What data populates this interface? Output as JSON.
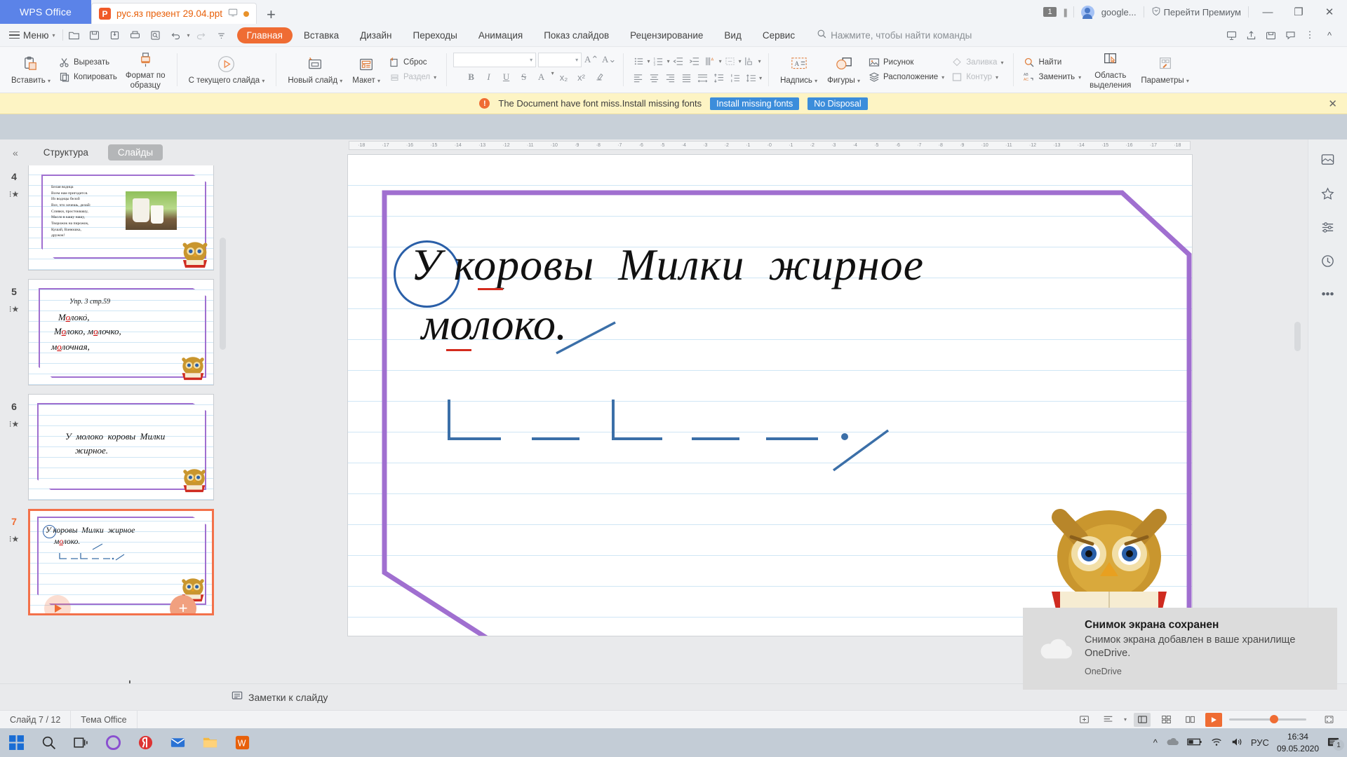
{
  "titlebar": {
    "app_name": "WPS Office",
    "doc_tab": {
      "label": "рус.яз презент 29.04.ppt",
      "badge": "P"
    },
    "new_tab": "+",
    "window_count": "1",
    "account": "google...",
    "premium": "Перейти Премиум",
    "minimize": "—",
    "restore": "❐",
    "close": "✕"
  },
  "menubar": {
    "menu_label": "Меню",
    "tabs": [
      {
        "label": "Главная",
        "active": true
      },
      {
        "label": "Вставка",
        "active": false
      },
      {
        "label": "Дизайн",
        "active": false
      },
      {
        "label": "Переходы",
        "active": false
      },
      {
        "label": "Анимация",
        "active": false
      },
      {
        "label": "Показ слайдов",
        "active": false
      },
      {
        "label": "Рецензирование",
        "active": false
      },
      {
        "label": "Вид",
        "active": false
      },
      {
        "label": "Сервис",
        "active": false
      }
    ],
    "search_placeholder": "Нажмите, чтобы найти команды"
  },
  "ribbon": {
    "paste": "Вставить",
    "cut": "Вырезать",
    "copy": "Копировать",
    "format_painter_l1": "Формат по",
    "format_painter_l2": "образцу",
    "from_current_slide": "С текущего слайда",
    "new_slide": "Новый слайд",
    "layout": "Макет",
    "reset": "Сброс",
    "section": "Раздел",
    "font_name": "",
    "font_size": "",
    "bold": "B",
    "italic": "I",
    "underline": "U",
    "strike": "S",
    "text_color": "A",
    "textbox": "Надпись",
    "shapes": "Фигуры",
    "picture": "Рисунок",
    "arrange": "Расположение",
    "fill": "Заливка",
    "outline": "Контур",
    "find": "Найти",
    "replace": "Заменить",
    "selection_pane_l1": "Область",
    "selection_pane_l2": "выделения",
    "parameters": "Параметры"
  },
  "notice": {
    "message": "The Document have font miss.Install missing fonts",
    "install_button": "Install missing fonts",
    "dismiss_button": "No Disposal",
    "close": "✕"
  },
  "sidebar": {
    "collapse": "«",
    "tab_outline": "Структура",
    "tab_slides": "Слайды",
    "add_slide": "+",
    "slides": [
      {
        "number": "4",
        "selected": false,
        "poem": [
          "Белая водица",
          "Всем нам пригодится.",
          "Из водицы белой",
          "Все, что хочешь, делай:",
          "Сливки, простоквашу,",
          "Масло в кашу нашу,",
          "Творожок на пирожок,",
          "Кушай, Ванюшка,",
          "дружок!"
        ]
      },
      {
        "number": "5",
        "selected": false,
        "heading": "Упр. 3 стр.59",
        "lines": [
          "Молоко,",
          "Молоко, молочко,",
          "молочная,"
        ]
      },
      {
        "number": "6",
        "selected": false,
        "lines": [
          "У  молоко  коровы  Милки",
          "жирное."
        ]
      },
      {
        "number": "7",
        "selected": true,
        "lines": [
          "У  коровы  Милки  жирное",
          "молоко."
        ]
      }
    ]
  },
  "editor": {
    "ruler_marks": [
      "18",
      "17",
      "16",
      "15",
      "14",
      "13",
      "12",
      "11",
      "10",
      "9",
      "8",
      "7",
      "6",
      "5",
      "4",
      "3",
      "2",
      "1",
      "0",
      "1",
      "2",
      "3",
      "4",
      "5",
      "6",
      "7",
      "8",
      "9",
      "10",
      "11",
      "12",
      "13",
      "14",
      "15",
      "16",
      "17",
      "18"
    ],
    "slide": {
      "line1": "У коровы  Милки  жирное",
      "line2": "молоко.",
      "circled_word": "У"
    },
    "notes_label": "Заметки к слайду",
    "notes_icon": "notes-icon"
  },
  "statusbar": {
    "slide_counter": "Слайд 7 / 12",
    "theme": "Тема Office",
    "zoom_percent": ""
  },
  "toast": {
    "title": "Снимок экрана сохранен",
    "body": "Снимок экрана добавлен в ваше хранилище OneDrive.",
    "app": "OneDrive"
  },
  "taskbar": {
    "language": "РУС",
    "time": "16:34",
    "date": "09.05.2020",
    "notification_count": "1"
  },
  "colors": {
    "accent": "#ef6c33",
    "brand_blue": "#5b83e8",
    "notice_bg": "#fdf4c4",
    "frame_purple": "#a06fd0"
  }
}
